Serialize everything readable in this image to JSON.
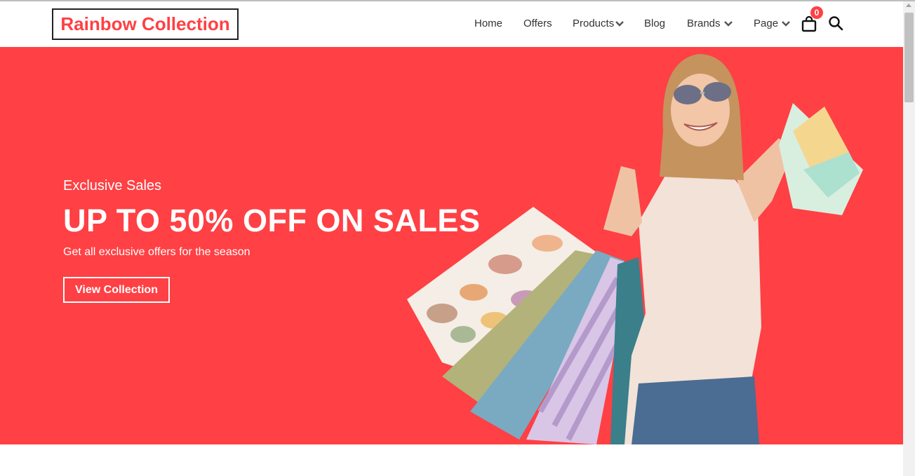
{
  "brand": {
    "logo_text": "Rainbow Collection",
    "accent_color": "#ff4044"
  },
  "nav": {
    "items": [
      {
        "label": "Home",
        "has_dropdown": false
      },
      {
        "label": "Offers",
        "has_dropdown": false
      },
      {
        "label": "Products",
        "has_dropdown": true
      },
      {
        "label": "Blog",
        "has_dropdown": false
      },
      {
        "label": "Brands",
        "has_dropdown": true
      },
      {
        "label": "Page",
        "has_dropdown": true
      }
    ],
    "cart_count": "0",
    "icons": [
      "shopping-bag-icon",
      "search-icon",
      "chevron-down-icon"
    ]
  },
  "hero": {
    "subtitle": "Exclusive Sales",
    "headline": "UP TO 50% OFF ON SALES",
    "description": "Get all exclusive offers for the season",
    "cta_label": "View Collection",
    "background_color": "#ff4044"
  }
}
